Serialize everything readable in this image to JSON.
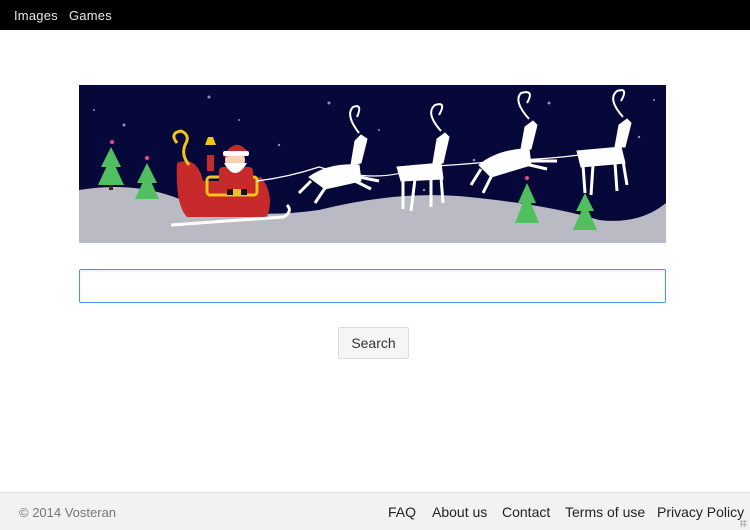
{
  "topbar": {
    "links": [
      {
        "label": "Images"
      },
      {
        "label": "Games"
      }
    ]
  },
  "banner": {
    "icon": "christmas-sleigh-doodle",
    "colors": {
      "sky": "#07083a",
      "snow": "#b9bac4",
      "tree": "#4fbf5f",
      "sleigh": "#c62a2a"
    }
  },
  "search": {
    "value": "",
    "placeholder": "",
    "button_label": "Search"
  },
  "footer": {
    "copyright": "© 2014 Vosteran",
    "links": [
      {
        "label": "FAQ"
      },
      {
        "label": "About us"
      },
      {
        "label": "Contact"
      },
      {
        "label": "Terms of use"
      },
      {
        "label": "Privacy Policy"
      }
    ]
  }
}
